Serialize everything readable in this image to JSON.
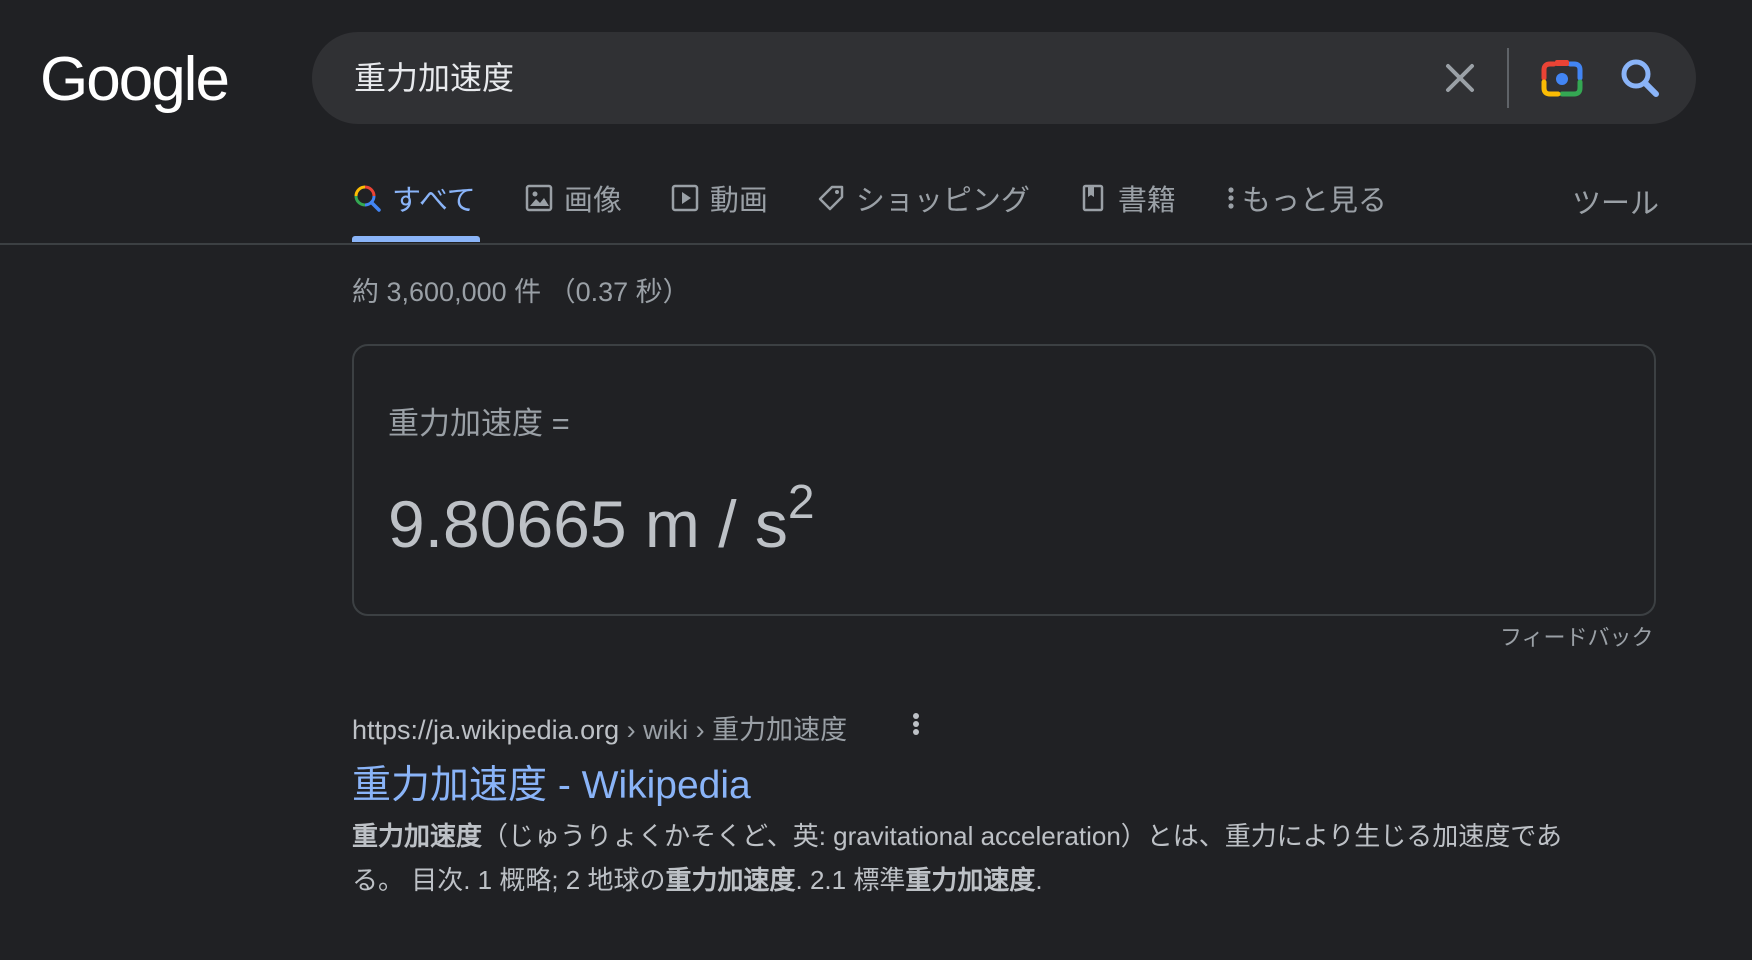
{
  "logo": {
    "text": "Google"
  },
  "search": {
    "query": "重力加速度",
    "clear_icon": "close-icon",
    "lens_icon": "camera-icon",
    "search_icon": "search-icon"
  },
  "tabs": [
    {
      "label": "すべて",
      "icon": "search-icon",
      "active": true
    },
    {
      "label": "画像",
      "icon": "image-icon",
      "active": false
    },
    {
      "label": "動画",
      "icon": "play-icon",
      "active": false
    },
    {
      "label": "ショッピング",
      "icon": "tag-icon",
      "active": false
    },
    {
      "label": "書籍",
      "icon": "book-icon",
      "active": false
    },
    {
      "label": "もっと見る",
      "icon": "more-vert-icon",
      "active": false
    }
  ],
  "tools_label": "ツール",
  "stats": "約 3,600,000 件 （0.37 秒）",
  "converter": {
    "label": "重力加速度 =",
    "value": "9.80665 m / s",
    "exponent": "2"
  },
  "feedback_label": "フィードバック",
  "result": {
    "url_host": "https://ja.wikipedia.org",
    "url_path": " › wiki › 重力加速度",
    "title": "重力加速度 - Wikipedia",
    "snippet": {
      "b1": "重力加速度",
      "t1": "（じゅうりょくかそくど、英: gravitational acceleration）とは、重力により生じる加速度である。 目次. 1 概略; 2 地球の",
      "b2": "重力加速度",
      "t2": ". 2.1 標準",
      "b3": "重力加速度",
      "t3": "."
    }
  },
  "colors": {
    "background": "#202124",
    "link": "#8ab4f8",
    "text": "#bdc1c6",
    "muted": "#9aa0a6"
  }
}
